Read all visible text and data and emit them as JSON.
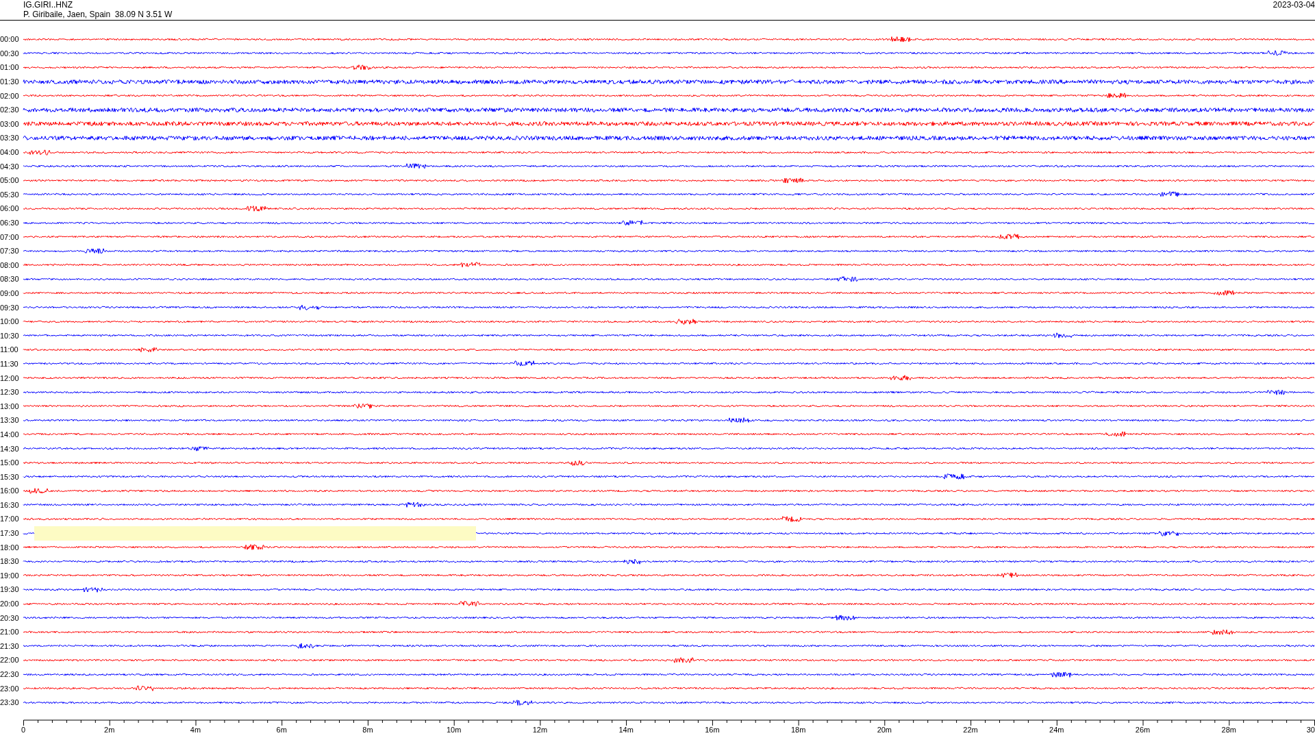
{
  "header": {
    "station": "IG.GIRI..HNZ",
    "location": "P. Giribaile, Jaen, Spain  38.09 N 3.51 W",
    "date": "2023-03-04"
  },
  "rows": [
    {
      "label": "00:00",
      "color": "#ff0000",
      "kind": "quiet",
      "highlighted": false
    },
    {
      "label": "00:30",
      "color": "#0000ff",
      "kind": "quiet",
      "highlighted": false
    },
    {
      "label": "01:00",
      "color": "#ff0000",
      "kind": "quiet",
      "highlighted": false
    },
    {
      "label": "01:30",
      "color": "#0000ff",
      "kind": "noisy",
      "highlighted": false
    },
    {
      "label": "02:00",
      "color": "#ff0000",
      "kind": "quiet",
      "highlighted": false
    },
    {
      "label": "02:30",
      "color": "#0000ff",
      "kind": "noisy",
      "highlighted": false
    },
    {
      "label": "03:00",
      "color": "#ff0000",
      "kind": "noisy",
      "highlighted": false
    },
    {
      "label": "03:30",
      "color": "#0000ff",
      "kind": "noisy",
      "highlighted": false
    },
    {
      "label": "04:00",
      "color": "#ff0000",
      "kind": "quiet",
      "highlighted": false
    },
    {
      "label": "04:30",
      "color": "#0000ff",
      "kind": "quiet",
      "highlighted": false
    },
    {
      "label": "05:00",
      "color": "#ff0000",
      "kind": "quiet",
      "highlighted": false
    },
    {
      "label": "05:30",
      "color": "#0000ff",
      "kind": "quiet",
      "highlighted": false
    },
    {
      "label": "06:00",
      "color": "#ff0000",
      "kind": "quiet",
      "highlighted": false
    },
    {
      "label": "06:30",
      "color": "#0000ff",
      "kind": "quiet",
      "highlighted": false
    },
    {
      "label": "07:00",
      "color": "#ff0000",
      "kind": "quiet",
      "highlighted": false
    },
    {
      "label": "07:30",
      "color": "#0000ff",
      "kind": "quiet",
      "highlighted": false
    },
    {
      "label": "08:00",
      "color": "#ff0000",
      "kind": "quiet",
      "highlighted": false
    },
    {
      "label": "08:30",
      "color": "#0000ff",
      "kind": "quiet",
      "highlighted": false
    },
    {
      "label": "09:00",
      "color": "#ff0000",
      "kind": "quiet",
      "highlighted": false
    },
    {
      "label": "09:30",
      "color": "#0000ff",
      "kind": "quiet",
      "highlighted": false
    },
    {
      "label": "10:00",
      "color": "#ff0000",
      "kind": "quiet",
      "highlighted": false
    },
    {
      "label": "10:30",
      "color": "#0000ff",
      "kind": "quiet",
      "highlighted": false
    },
    {
      "label": "11:00",
      "color": "#ff0000",
      "kind": "quiet",
      "highlighted": false
    },
    {
      "label": "11:30",
      "color": "#0000ff",
      "kind": "quiet",
      "highlighted": false
    },
    {
      "label": "12:00",
      "color": "#ff0000",
      "kind": "quiet",
      "highlighted": false
    },
    {
      "label": "12:30",
      "color": "#0000ff",
      "kind": "quiet",
      "highlighted": false
    },
    {
      "label": "13:00",
      "color": "#ff0000",
      "kind": "quiet",
      "highlighted": false
    },
    {
      "label": "13:30",
      "color": "#0000ff",
      "kind": "quiet",
      "highlighted": false
    },
    {
      "label": "14:00",
      "color": "#ff0000",
      "kind": "quiet",
      "highlighted": false
    },
    {
      "label": "14:30",
      "color": "#0000ff",
      "kind": "quiet",
      "highlighted": false
    },
    {
      "label": "15:00",
      "color": "#ff0000",
      "kind": "quiet",
      "highlighted": false
    },
    {
      "label": "15:30",
      "color": "#0000ff",
      "kind": "quiet",
      "highlighted": false
    },
    {
      "label": "16:00",
      "color": "#ff0000",
      "kind": "quiet",
      "highlighted": false
    },
    {
      "label": "16:30",
      "color": "#0000ff",
      "kind": "quiet",
      "highlighted": false
    },
    {
      "label": "17:00",
      "color": "#ff0000",
      "kind": "quiet",
      "highlighted": false
    },
    {
      "label": "17:30",
      "color": "#0000ff",
      "kind": "quiet",
      "highlighted": true
    },
    {
      "label": "18:00",
      "color": "#ff0000",
      "kind": "quiet",
      "highlighted": false
    },
    {
      "label": "18:30",
      "color": "#0000ff",
      "kind": "quiet",
      "highlighted": false
    },
    {
      "label": "19:00",
      "color": "#ff0000",
      "kind": "quiet",
      "highlighted": false
    },
    {
      "label": "19:30",
      "color": "#0000ff",
      "kind": "quiet",
      "highlighted": false
    },
    {
      "label": "20:00",
      "color": "#ff0000",
      "kind": "quiet",
      "highlighted": false
    },
    {
      "label": "20:30",
      "color": "#0000ff",
      "kind": "quiet",
      "highlighted": false
    },
    {
      "label": "21:00",
      "color": "#ff0000",
      "kind": "quiet",
      "highlighted": false
    },
    {
      "label": "21:30",
      "color": "#0000ff",
      "kind": "quiet",
      "highlighted": false
    },
    {
      "label": "22:00",
      "color": "#ff0000",
      "kind": "quiet",
      "highlighted": false
    },
    {
      "label": "22:30",
      "color": "#0000ff",
      "kind": "quiet",
      "highlighted": false
    },
    {
      "label": "23:00",
      "color": "#ff0000",
      "kind": "quiet",
      "highlighted": false
    },
    {
      "label": "23:30",
      "color": "#0000ff",
      "kind": "quiet",
      "highlighted": false
    }
  ],
  "x_axis": {
    "labels": [
      "0",
      "2m",
      "4m",
      "6m",
      "8m",
      "10m",
      "12m",
      "14m",
      "16m",
      "18m",
      "20m",
      "22m",
      "24m",
      "26m",
      "28m",
      "30"
    ]
  }
}
